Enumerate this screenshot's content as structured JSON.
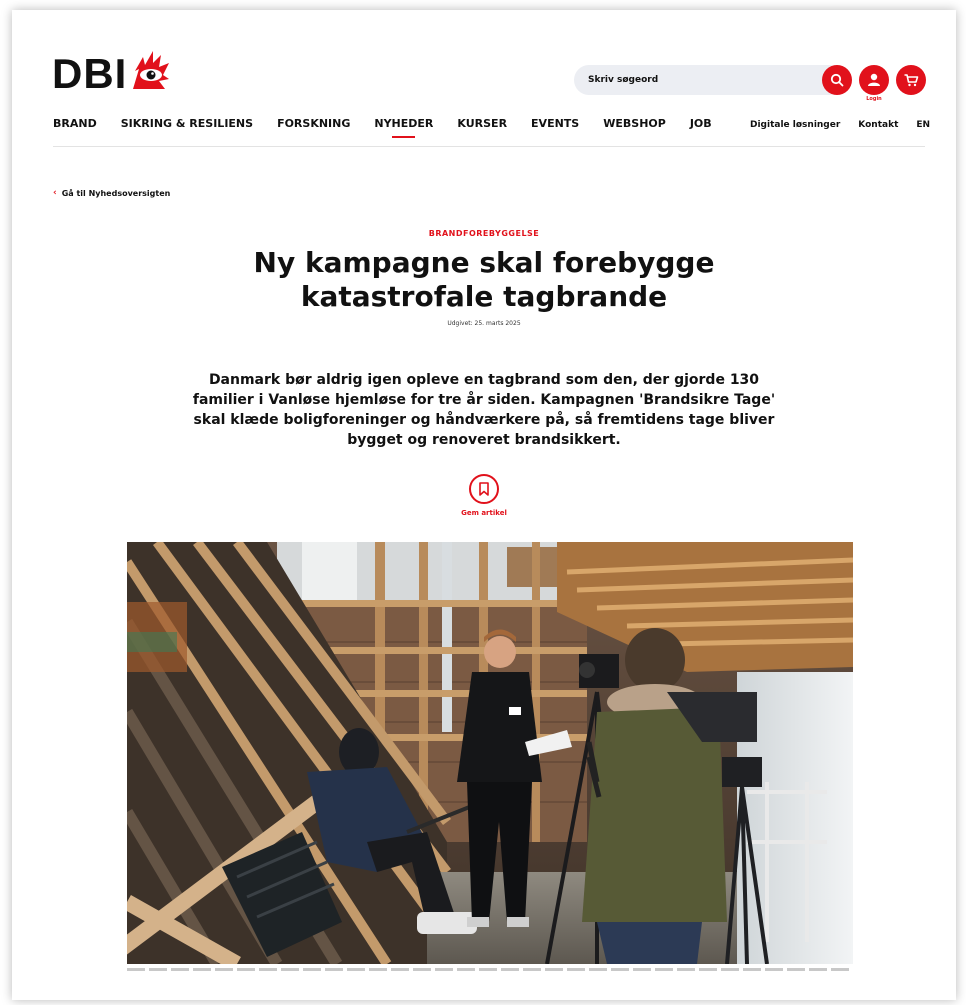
{
  "header": {
    "logo_text": "DBI",
    "search_placeholder": "Skriv søgeord",
    "login_label": "Login",
    "brand_color": "#e1111b"
  },
  "nav": {
    "items": [
      {
        "label": "BRAND"
      },
      {
        "label": "SIKRING & RESILIENS"
      },
      {
        "label": "FORSKNING"
      },
      {
        "label": "NYHEDER",
        "active": true
      },
      {
        "label": "KURSER"
      },
      {
        "label": "EVENTS"
      },
      {
        "label": "WEBSHOP"
      },
      {
        "label": "JOB"
      }
    ],
    "secondary": [
      {
        "label": "Digitale løsninger"
      },
      {
        "label": "Kontakt"
      },
      {
        "label": "EN"
      }
    ]
  },
  "article": {
    "back_link": "Gå til Nyhedsoversigten",
    "category": "BRANDFOREBYGGELSE",
    "title": "Ny kampagne skal forebygge katastrofale tagbrande",
    "date": "Udgivet: 25. marts 2025",
    "lead": "Danmark bør aldrig igen opleve en tagbrand som den, der gjorde 130 familier i Vanløse hjemløse for tre år siden. Kampagnen 'Brandsikre Tage' skal klæde boligforeninger og håndværkere på, så fremtidens tage bliver bygget og renoveret brandsikkert.",
    "save_label": "Gem artikel"
  },
  "icons": {
    "search": "search-icon",
    "login": "user-icon",
    "cart": "cart-icon",
    "back": "chevron-left-icon",
    "save": "bookmark-icon"
  }
}
